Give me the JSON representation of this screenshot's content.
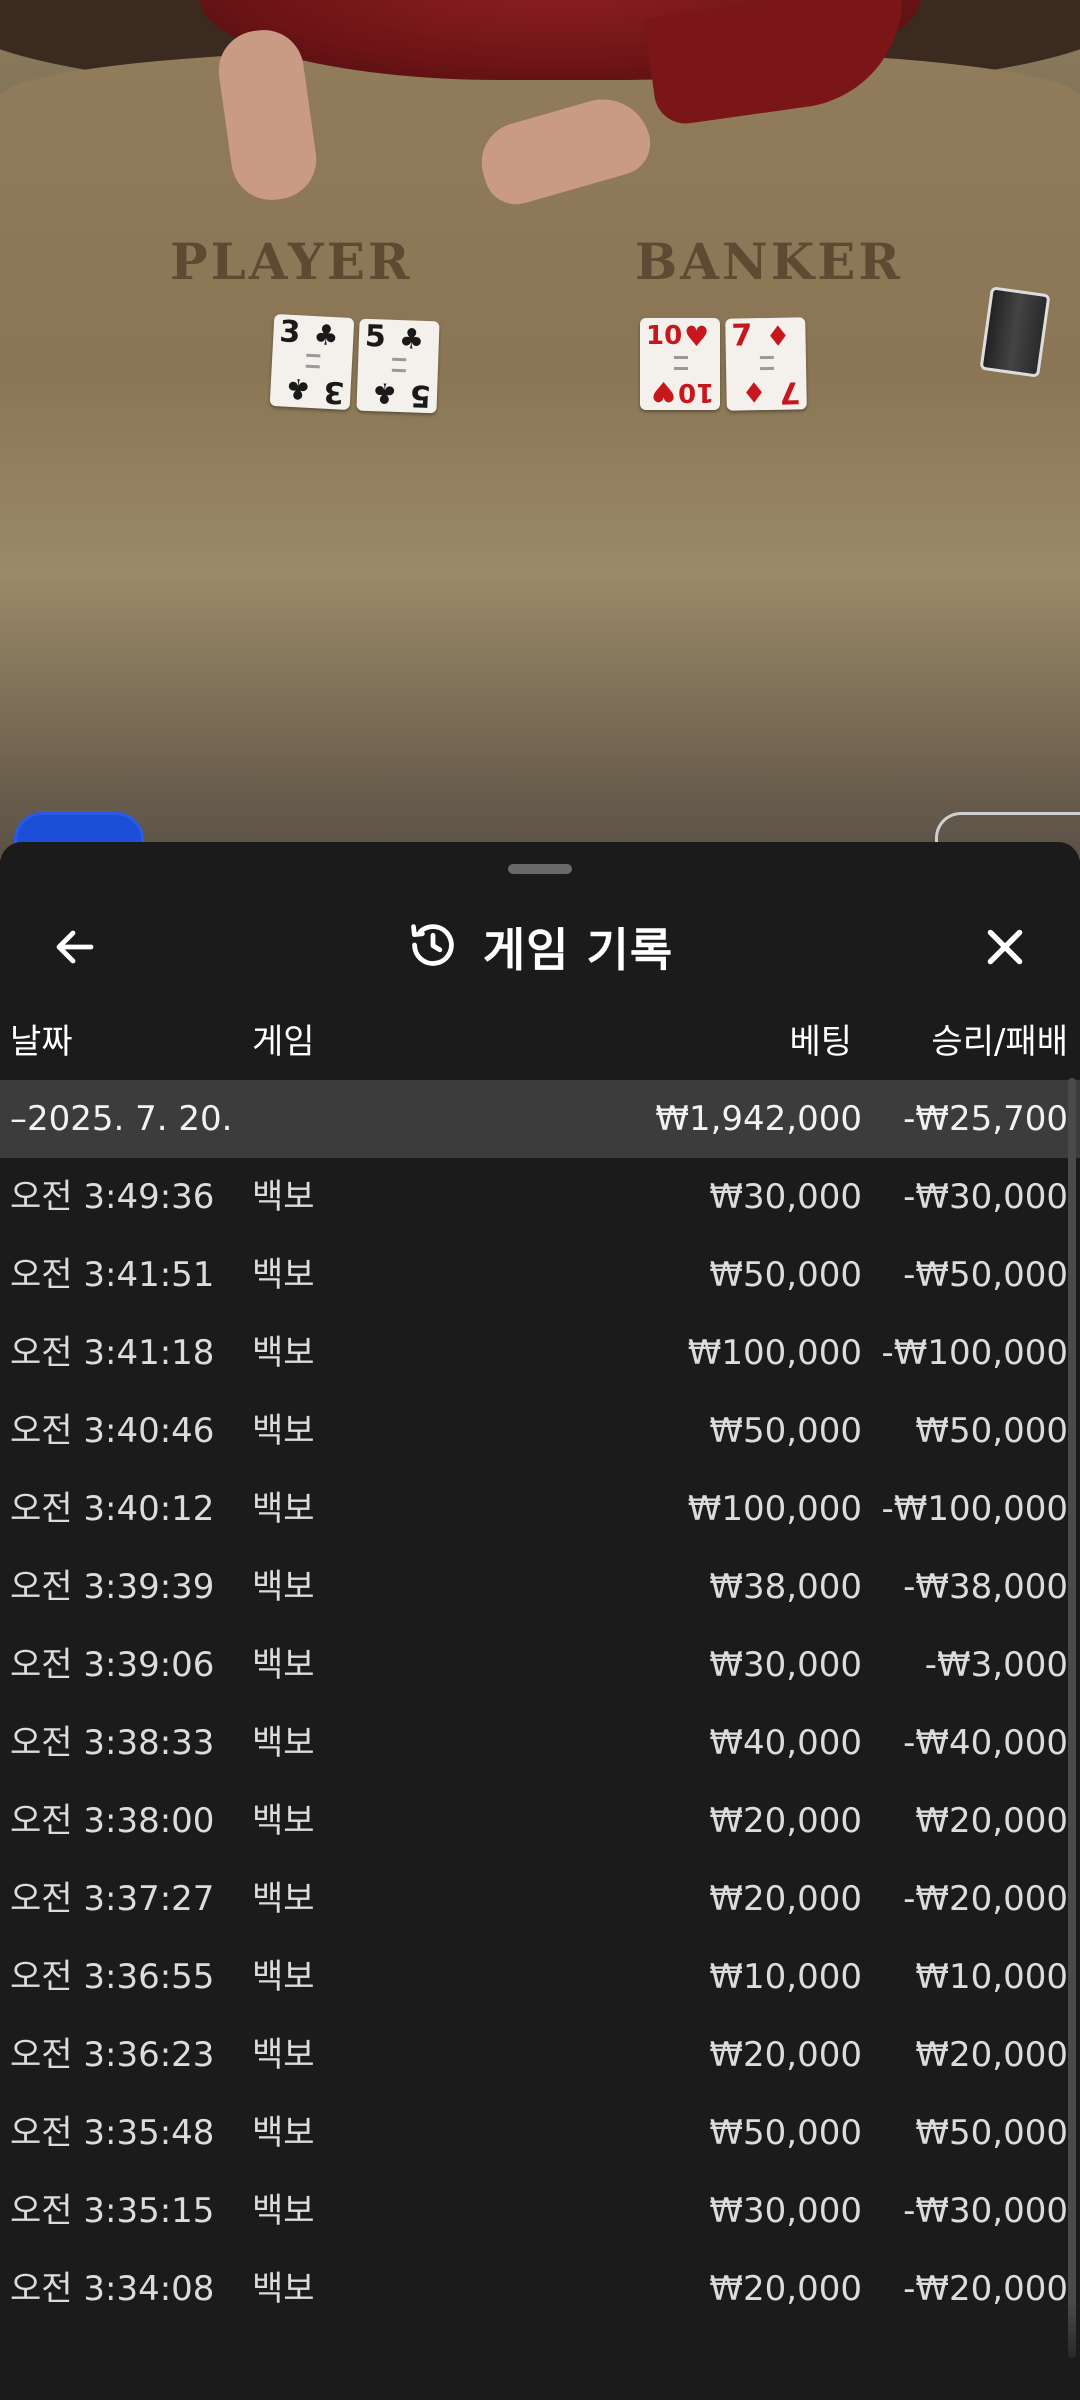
{
  "table": {
    "player_label": "PLAYER",
    "banker_label": "BANKER",
    "player_cards": [
      {
        "rank": "3",
        "suit": "♣",
        "color": "black"
      },
      {
        "rank": "5",
        "suit": "♣",
        "color": "black"
      }
    ],
    "banker_cards": [
      {
        "rank": "10",
        "suit": "♥",
        "color": "red"
      },
      {
        "rank": "7",
        "suit": "♦",
        "color": "red"
      }
    ]
  },
  "sheet": {
    "title": "게임 기록",
    "back_icon": "arrow-left-icon",
    "history_icon": "history-icon",
    "close_icon": "close-icon"
  },
  "columns": {
    "date": "날짜",
    "game": "게임",
    "bet": "베팅",
    "result": "승리/패배"
  },
  "date_group": {
    "date": "–2025. 7. 20.",
    "total_bet": "₩1,942,000",
    "total_result": "-₩25,700"
  },
  "rows": [
    {
      "time": "오전 3:49:36",
      "game": "백보",
      "bet": "₩30,000",
      "result": "-₩30,000"
    },
    {
      "time": "오전 3:41:51",
      "game": "백보",
      "bet": "₩50,000",
      "result": "-₩50,000"
    },
    {
      "time": "오전 3:41:18",
      "game": "백보",
      "bet": "₩100,000",
      "result": "-₩100,000"
    },
    {
      "time": "오전 3:40:46",
      "game": "백보",
      "bet": "₩50,000",
      "result": "₩50,000"
    },
    {
      "time": "오전 3:40:12",
      "game": "백보",
      "bet": "₩100,000",
      "result": "-₩100,000"
    },
    {
      "time": "오전 3:39:39",
      "game": "백보",
      "bet": "₩38,000",
      "result": "-₩38,000"
    },
    {
      "time": "오전 3:39:06",
      "game": "백보",
      "bet": "₩30,000",
      "result": "-₩3,000"
    },
    {
      "time": "오전 3:38:33",
      "game": "백보",
      "bet": "₩40,000",
      "result": "-₩40,000"
    },
    {
      "time": "오전 3:38:00",
      "game": "백보",
      "bet": "₩20,000",
      "result": "₩20,000"
    },
    {
      "time": "오전 3:37:27",
      "game": "백보",
      "bet": "₩20,000",
      "result": "-₩20,000"
    },
    {
      "time": "오전 3:36:55",
      "game": "백보",
      "bet": "₩10,000",
      "result": "₩10,000"
    },
    {
      "time": "오전 3:36:23",
      "game": "백보",
      "bet": "₩20,000",
      "result": "₩20,000"
    },
    {
      "time": "오전 3:35:48",
      "game": "백보",
      "bet": "₩50,000",
      "result": "₩50,000"
    },
    {
      "time": "오전 3:35:15",
      "game": "백보",
      "bet": "₩30,000",
      "result": "-₩30,000"
    },
    {
      "time": "오전 3:34:08",
      "game": "백보",
      "bet": "₩20,000",
      "result": "-₩20,000"
    }
  ],
  "colors": {
    "sheet_bg": "#1b1b1b",
    "date_row_bg": "#3c3c3c",
    "text_primary": "#ffffff",
    "text_row": "#dcdcdc",
    "chip_tab": "#1b4fd8"
  }
}
